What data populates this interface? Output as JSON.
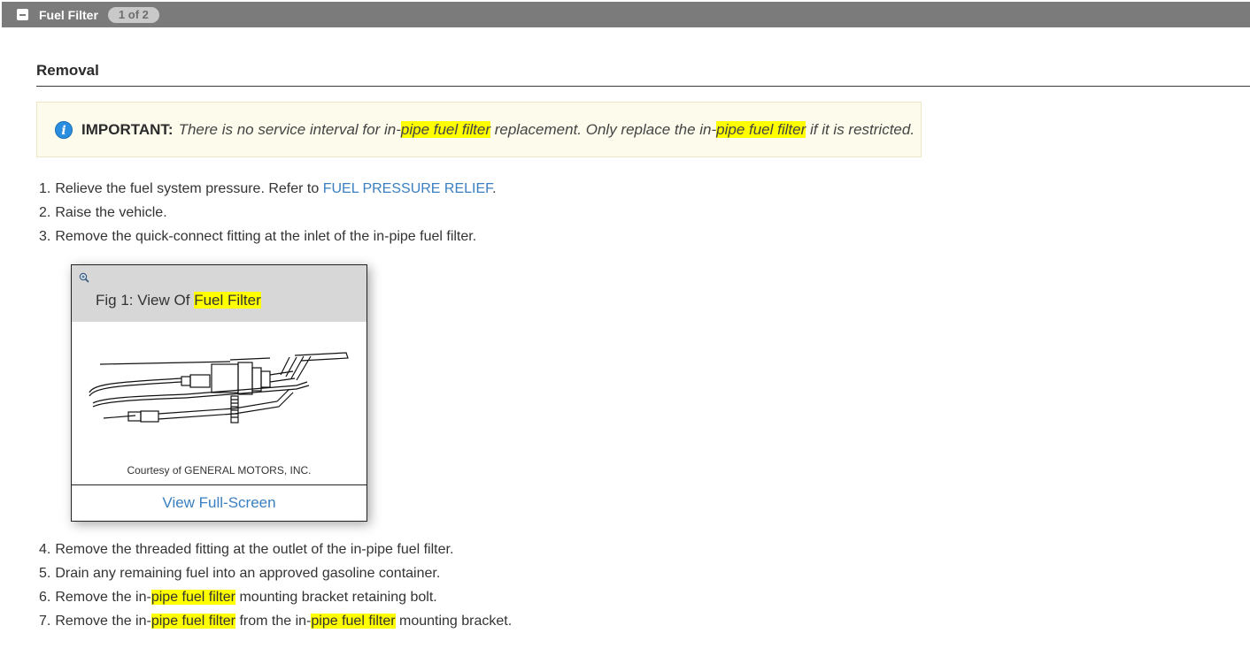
{
  "header": {
    "title": "Fuel Filter",
    "badge": "1 of 2"
  },
  "section": {
    "title": "Removal"
  },
  "important": {
    "label": "IMPORTANT:",
    "text_1": "There is no service interval for in-",
    "hl_1": "pipe fuel filter",
    "text_2": " replacement. Only replace the in-",
    "hl_2": "pipe fuel filter",
    "text_3": " if it is restricted."
  },
  "steps": [
    {
      "num": "1.",
      "text": "Relieve the fuel system pressure. Refer to ",
      "link": "FUEL PRESSURE RELIEF",
      "after": "."
    },
    {
      "num": "2.",
      "text": "Raise the vehicle."
    },
    {
      "num": "3.",
      "text": "Remove the quick-connect fitting at the inlet of the in-pipe fuel filter."
    },
    {
      "num": "4.",
      "text": "Remove the threaded fitting at the outlet of the in-pipe fuel filter."
    },
    {
      "num": "5.",
      "text": "Drain any remaining fuel into an approved gasoline container."
    },
    {
      "num": "6.",
      "pre": "Remove the in-",
      "hl": "pipe fuel filter",
      "post": " mounting bracket retaining bolt."
    },
    {
      "num": "7.",
      "pre": "Remove the in-",
      "hl": "pipe fuel filter",
      "mid": " from the in-",
      "hl2": "pipe fuel filter",
      "post": " mounting bracket."
    }
  ],
  "figure": {
    "title_prefix": "Fig 1: View Of ",
    "title_highlight": "Fuel Filter",
    "credit": "Courtesy of GENERAL MOTORS, INC.",
    "button_label": "View Full-Screen",
    "zoom_icon": "magnify-plus-icon"
  },
  "colors": {
    "header_bg": "#7b7b7b",
    "link": "#3a7fc1",
    "highlight": "#ffff00",
    "note_bg": "#fdfbeb"
  }
}
